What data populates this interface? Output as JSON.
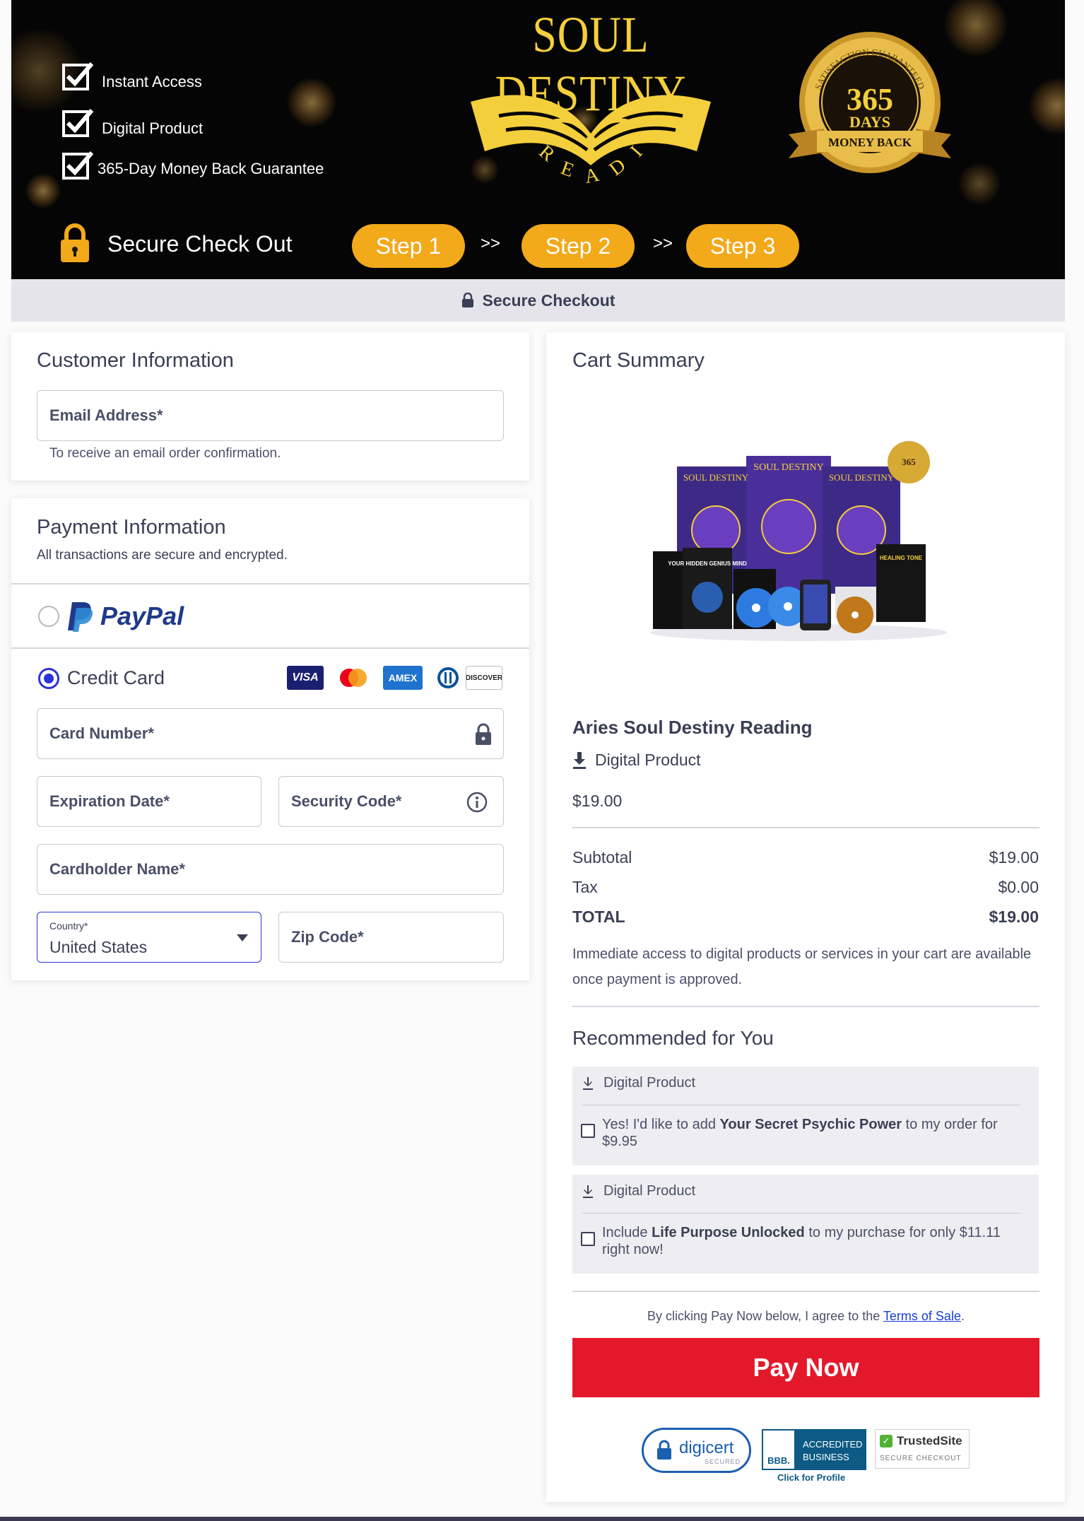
{
  "banner": {
    "brand_title": "SOUL DESTINY",
    "brand_subtitle": "READING",
    "badges": [
      "Instant Access",
      "Digital Product",
      "365-Day Money Back Guarantee"
    ],
    "seal": {
      "arc_text": "SATISFACTION GUARANTEED",
      "number": "365",
      "days": "DAYS",
      "ribbon": "MONEY BACK"
    },
    "secure_label": "Secure Check Out",
    "steps": [
      "Step 1",
      "Step 2",
      "Step 3"
    ],
    "step_separator": ">>"
  },
  "secure_bar": {
    "label": "Secure Checkout"
  },
  "customer": {
    "title": "Customer Information",
    "email_placeholder": "Email Address*",
    "email_hint": "To receive an email order confirmation."
  },
  "payment": {
    "title": "Payment Information",
    "subtitle": "All transactions are secure and encrypted.",
    "paypal_label": "PayPal",
    "credit_card_label": "Credit Card",
    "selected_method": "Credit Card",
    "card_brands": [
      "VISA",
      "Mastercard",
      "AMEX",
      "Diners Club",
      "DISCOVER"
    ],
    "card_number": "Card Number*",
    "expiration": "Expiration Date*",
    "security_code": "Security Code*",
    "cardholder": "Cardholder Name*",
    "country_label": "Country*",
    "country_value": "United States",
    "zip": "Zip Code*"
  },
  "cart": {
    "title": "Cart Summary",
    "product_name": "Aries Soul Destiny Reading",
    "product_type": "Digital Product",
    "product_price": "$19.00",
    "subtotal_label": "Subtotal",
    "subtotal_value": "$19.00",
    "tax_label": "Tax",
    "tax_value": "$0.00",
    "total_label": "TOTAL",
    "total_value": "$19.00",
    "access_note": "Immediate access to digital products or services in your cart are available once payment is approved.",
    "product_image_texts": {
      "book_title": "SOUL DESTINY",
      "seal_number": "365",
      "small_book": "YOUR HIDDEN GENIUS MIND",
      "disc_title": "HEALING TONE"
    }
  },
  "recommended": {
    "title": "Recommended for You",
    "items": [
      {
        "type": "Digital Product",
        "pre": "Yes! I'd like to add ",
        "name": "Your Secret Psychic Power",
        "post": " to my order for $9.95"
      },
      {
        "type": "Digital Product",
        "pre": "Include ",
        "name": "Life Purpose Unlocked",
        "post": " to my purchase for only $11.11 right now!"
      }
    ]
  },
  "terms": {
    "pre": "By clicking Pay Now below, I agree to the ",
    "link": "Terms of Sale",
    "post": "."
  },
  "pay_button": "Pay Now",
  "trust": {
    "digicert": "digicert",
    "digicert_sub": "SECURED",
    "bbb_line1": "ACCREDITED",
    "bbb_line2": "BUSINESS",
    "bbb_logo": "BBB.",
    "bbb_link": "Click for Profile",
    "trustedsite": "TrustedSite",
    "trustedsite_sub": "SECURE CHECKOUT"
  },
  "colors": {
    "accent": "#2b34d6",
    "pay_button": "#e3192b",
    "step": "#f2a91a",
    "gold": "#f4cf3c"
  }
}
